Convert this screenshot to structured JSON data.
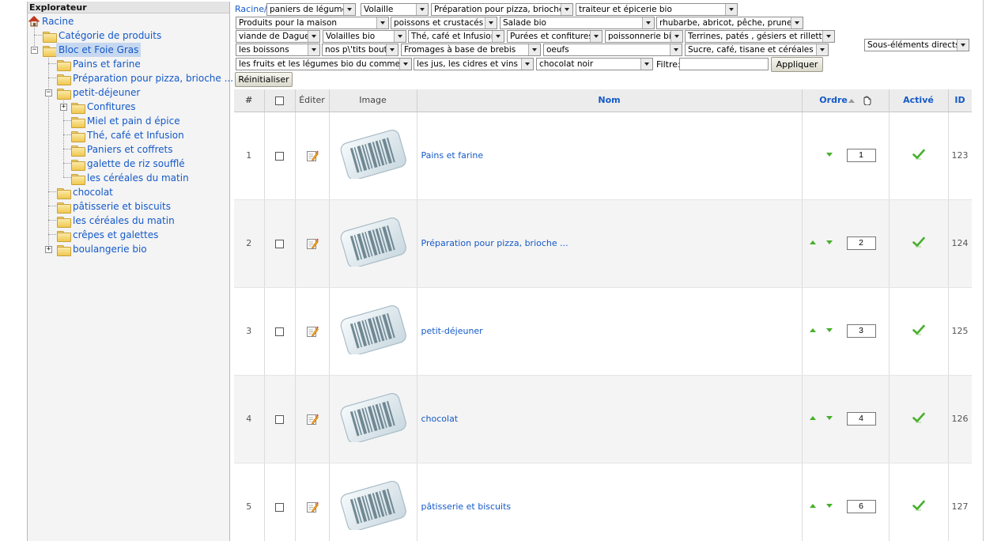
{
  "explorer": {
    "title": "Explorateur",
    "root": "Racine",
    "categorie": "Catégorie de produits",
    "selected": "Bloc et Foie Gras",
    "children": [
      "Pains et farine",
      "Préparation pour pizza, brioche ...",
      "petit-déjeuner"
    ],
    "petit_dejeuner_children": [
      "Confitures",
      "Miel et pain d épice",
      "Thé, café et Infusion",
      "Paniers et coffrets",
      "galette de riz soufflé",
      "les céréales du matin"
    ],
    "more_children": [
      "chocolat",
      "pâtisserie et biscuits",
      "les céréales du matin",
      "crêpes et galettes",
      "boulangerie bio"
    ]
  },
  "filters": {
    "crumb": "Racine/",
    "row1": [
      "paniers de légumes",
      "Volaille",
      "Préparation pour pizza, brioche ...",
      "traiteur et épicerie bio"
    ],
    "row2": [
      "Produits pour la maison",
      "poissons et crustacés",
      "Salade bio",
      "rhubarbe, abricot, pêche, prune"
    ],
    "row3": [
      "viande de Daguet",
      "Volailles bio",
      "Thé, café et Infusion",
      "Purées et confitures",
      "poissonnerie bio",
      "Terrines, patés , gésiers et rillettes"
    ],
    "row4": [
      "les boissons",
      "nos p\\'tits bouts",
      "Fromages à base de brebis",
      "oeufs",
      "Sucre, café, tisane et céréales bio"
    ],
    "row5": [
      "les fruits et les légumes bio du commerçant",
      "les jus, les cidres et vins bio",
      "chocolat noir"
    ],
    "filter_label": "Filtre:",
    "filter_value": "",
    "apply_label": "Appliquer",
    "reset_label": "Réinitialiser",
    "scope_select": "Sous-éléments directs"
  },
  "table": {
    "headers": {
      "num": "#",
      "edit": "Éditer",
      "image": "Image",
      "name": "Nom",
      "order": "Ordre",
      "active": "Activé",
      "id": "ID"
    },
    "rows": [
      {
        "num": "1",
        "name": "Pains et farine",
        "order": "1",
        "id": "123"
      },
      {
        "num": "2",
        "name": "Préparation pour pizza, brioche ...",
        "order": "2",
        "id": "124"
      },
      {
        "num": "3",
        "name": "petit-déjeuner",
        "order": "3",
        "id": "125"
      },
      {
        "num": "4",
        "name": "chocolat",
        "order": "4",
        "id": "126"
      },
      {
        "num": "5",
        "name": "pâtisserie et biscuits",
        "order": "6",
        "id": "127"
      }
    ]
  },
  "colors": {
    "link": "#1459c8",
    "active_check": "#46b02c",
    "header_bg": "#ececec"
  }
}
